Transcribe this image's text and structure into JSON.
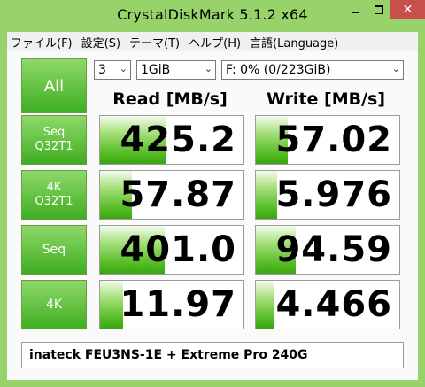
{
  "window": {
    "title": "CrystalDiskMark 5.1.2 x64",
    "close_glyph": "✕"
  },
  "menu": [
    {
      "label": "ファイル(F)"
    },
    {
      "label": "設定(S)"
    },
    {
      "label": "テーマ(T)"
    },
    {
      "label": "ヘルプ(H)"
    },
    {
      "label": "言語(Language)"
    }
  ],
  "controls": {
    "all_label": "All",
    "count": "3",
    "size": "1GiB",
    "drive": "F: 0% (0/223GiB)",
    "chevron": "⌄"
  },
  "headers": {
    "read": "Read [MB/s]",
    "write": "Write [MB/s]"
  },
  "rows": [
    {
      "line1": "Seq",
      "line2": "Q32T1",
      "read": "425.2",
      "write": "57.02",
      "read_level": 0.46,
      "write_level": 0.22
    },
    {
      "line1": "4K",
      "line2": "Q32T1",
      "read": "57.87",
      "write": "5.976",
      "read_level": 0.22,
      "write_level": 0.15
    },
    {
      "line1": "Seq",
      "line2": "",
      "read": "401.0",
      "write": "94.59",
      "read_level": 0.45,
      "write_level": 0.28
    },
    {
      "line1": "4K",
      "line2": "",
      "read": "11.97",
      "write": "4.466",
      "read_level": 0.16,
      "write_level": 0.13
    }
  ],
  "comment": "inateck FEU3NS-1E + Extreme Pro 240G"
}
